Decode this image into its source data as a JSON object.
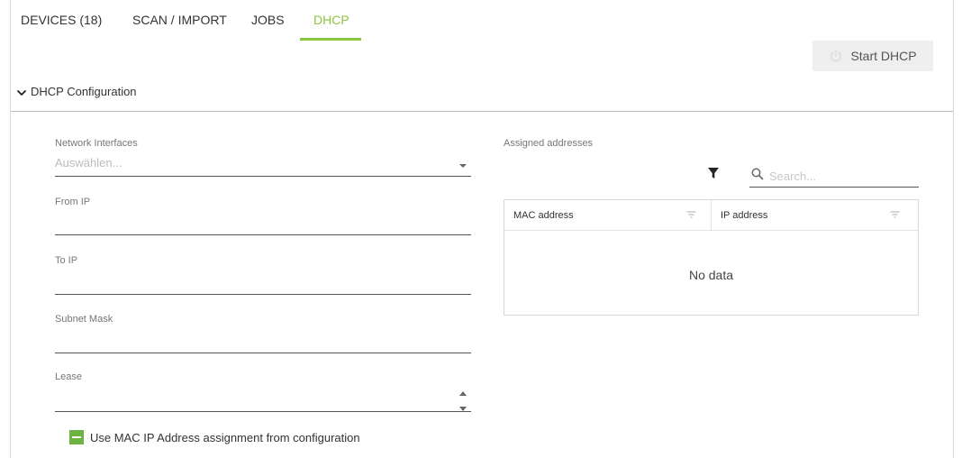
{
  "tabs": [
    {
      "label": "DEVICES (18)"
    },
    {
      "label": "SCAN / IMPORT"
    },
    {
      "label": "JOBS"
    },
    {
      "label": "DHCP"
    }
  ],
  "active_tab": "DHCP",
  "start_button": {
    "label": "Start DHCP"
  },
  "section": {
    "title": "DHCP Configuration"
  },
  "form": {
    "network_interfaces": {
      "label": "Network Interfaces",
      "placeholder": "Auswählen..."
    },
    "from_ip": {
      "label": "From IP",
      "value": ""
    },
    "to_ip": {
      "label": "To IP",
      "value": ""
    },
    "subnet_mask": {
      "label": "Subnet Mask",
      "value": ""
    },
    "lease": {
      "label": "Lease",
      "value": ""
    },
    "checkbox": {
      "label": "Use MAC IP Address assignment from configuration",
      "checked": true
    }
  },
  "assigned": {
    "label": "Assigned addresses",
    "search_placeholder": "Search...",
    "columns": [
      "MAC address",
      "IP address"
    ],
    "rows": [],
    "empty_text": "No data"
  },
  "colors": {
    "accent": "#8cc63e",
    "checkbox": "#6db33f"
  },
  "icons": {
    "filter": "filter-icon",
    "search": "search-icon",
    "dropdown": "chevron-down-icon",
    "start": "power-icon"
  }
}
